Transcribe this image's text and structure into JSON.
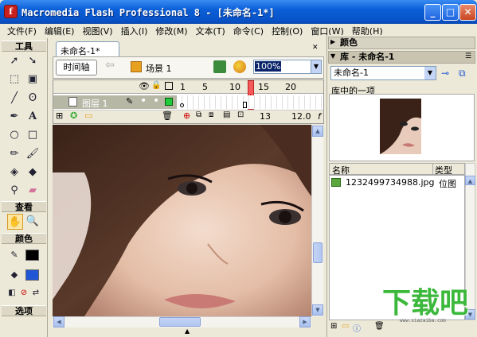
{
  "window": {
    "title": "Macromedia Flash Professional 8 - [未命名-1*]",
    "minimize": "_",
    "maximize": "□",
    "close": "✕"
  },
  "menubar": [
    {
      "label": "文件(F)"
    },
    {
      "label": "编辑(E)"
    },
    {
      "label": "视图(V)"
    },
    {
      "label": "插入(I)"
    },
    {
      "label": "修改(M)"
    },
    {
      "label": "文本(T)"
    },
    {
      "label": "命令(C)"
    },
    {
      "label": "控制(O)"
    },
    {
      "label": "窗口(W)"
    },
    {
      "label": "帮助(H)"
    }
  ],
  "toolbox": {
    "tools_label": "工具",
    "view_label": "查看",
    "colors_label": "颜色",
    "options_label": "选项"
  },
  "document": {
    "tab": "未命名-1*",
    "timeline_button": "时间轴",
    "scene": "场景 1",
    "zoom": "100%"
  },
  "timeline": {
    "frame_ticks": [
      "1",
      "5",
      "10",
      "15",
      "20"
    ],
    "layer_name": "图层 1",
    "current_frame": "13",
    "fps": "12.0",
    "fps_suffix": "f"
  },
  "panels": {
    "color_title": "颜色",
    "library_title": "库 - 未命名-1",
    "library_select": "未命名-1",
    "library_count": "库中的一项",
    "col_name": "名称",
    "col_type": "类型",
    "items": [
      {
        "name": "1232499734988.jpg",
        "type": "位图"
      }
    ]
  },
  "watermark": {
    "text": "下载吧",
    "url": "www.xiazaiba.com"
  },
  "colors": {
    "title_blue": "#0852c8",
    "stroke": "#000000",
    "fill": "#1f56d6",
    "playhead": "#f55a5a"
  }
}
